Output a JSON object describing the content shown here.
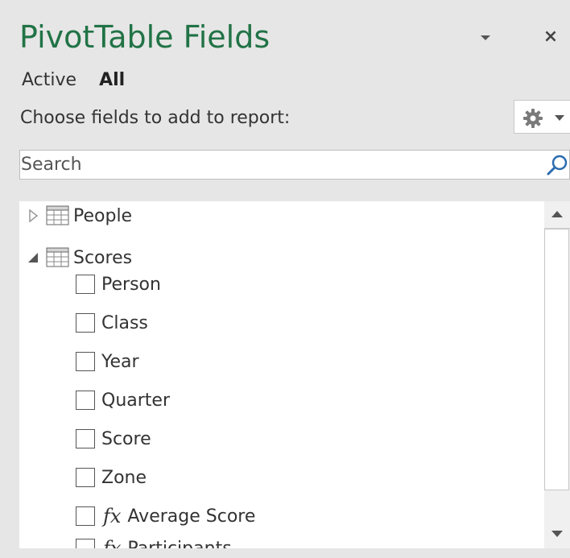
{
  "pane": {
    "title": "PivotTable Fields",
    "close_glyph": "×"
  },
  "tabs": [
    {
      "label": "Active",
      "selected": false
    },
    {
      "label": "All",
      "selected": true
    }
  ],
  "choose_label": "Choose fields to add to report:",
  "search": {
    "placeholder": "Search",
    "value": ""
  },
  "tables": [
    {
      "name": "People",
      "expanded": false,
      "fields": []
    },
    {
      "name": "Scores",
      "expanded": true,
      "fields": [
        {
          "label": "Person",
          "checked": false,
          "measure": false
        },
        {
          "label": "Class",
          "checked": false,
          "measure": false
        },
        {
          "label": "Year",
          "checked": false,
          "measure": false
        },
        {
          "label": "Quarter",
          "checked": false,
          "measure": false
        },
        {
          "label": "Score",
          "checked": false,
          "measure": false
        },
        {
          "label": "Zone",
          "checked": false,
          "measure": false
        },
        {
          "label": "Average Score",
          "checked": false,
          "measure": true
        },
        {
          "label": "Participants",
          "checked": false,
          "measure": true
        }
      ]
    }
  ],
  "icons": {
    "measure_glyph": "fx"
  },
  "colors": {
    "title": "#217346",
    "pane_bg": "#e6e6e6",
    "search_icon": "#2b6cb0"
  }
}
